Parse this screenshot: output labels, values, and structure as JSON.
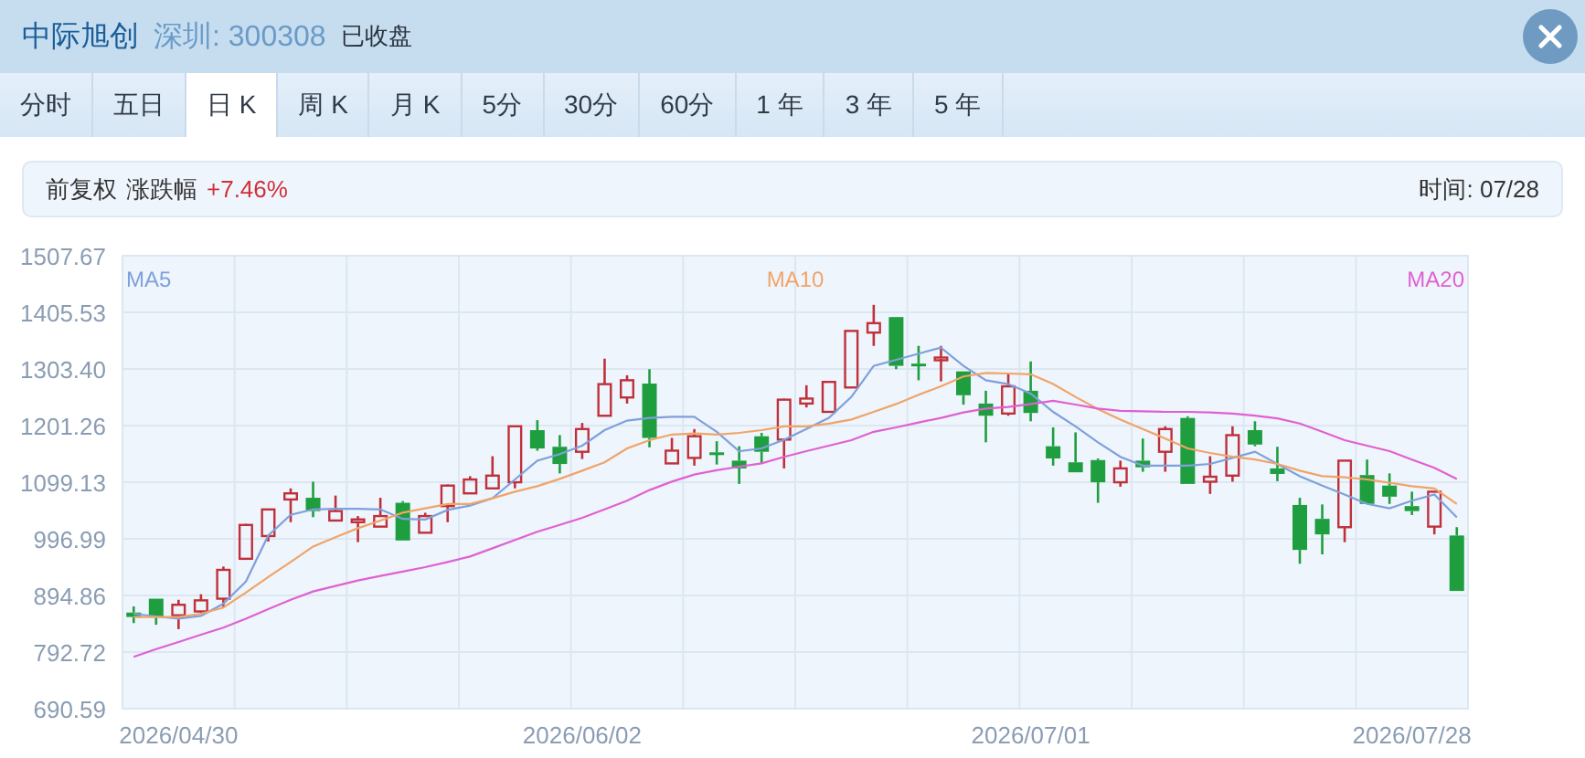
{
  "header": {
    "name": "中际旭创",
    "market": "深圳: 300308",
    "status": "已收盘"
  },
  "tabs": [
    {
      "label": "分时",
      "selected": false
    },
    {
      "label": "五日",
      "selected": false
    },
    {
      "label": "日 K",
      "selected": true
    },
    {
      "label": "周 K",
      "selected": false
    },
    {
      "label": "月 K",
      "selected": false
    },
    {
      "label": "5分",
      "selected": false
    },
    {
      "label": "30分",
      "selected": false
    },
    {
      "label": "60分",
      "selected": false
    },
    {
      "label": "1 年",
      "selected": false
    },
    {
      "label": "3 年",
      "selected": false
    },
    {
      "label": "5 年",
      "selected": false
    }
  ],
  "info": {
    "adjust": "前复权",
    "change_label": "涨跌幅",
    "change": "+7.46%",
    "time": "时间: 07/28"
  },
  "chart": {
    "chart_data": {
      "type": "candlestick",
      "categories": [
        null,
        null,
        "2026/04/30",
        null,
        null,
        null,
        null,
        null,
        null,
        null,
        null,
        null,
        null,
        null,
        null,
        null,
        null,
        null,
        null,
        null,
        "2026/06/02",
        null,
        null,
        null,
        null,
        null,
        null,
        null,
        null,
        null,
        null,
        null,
        null,
        null,
        null,
        null,
        null,
        null,
        null,
        null,
        "2026/07/01",
        null,
        null,
        null,
        null,
        null,
        null,
        null,
        null,
        null,
        null,
        null,
        null,
        null,
        null,
        null,
        null,
        "2026/07/28",
        null,
        null
      ],
      "series": [
        {
          "name": "MA5",
          "type": "line",
          "color": "#7fa0dc",
          "values": [
            862,
            857,
            853,
            858,
            880,
            920,
            1003,
            1040,
            1050,
            1051,
            1051,
            1050,
            1033,
            1032,
            1049,
            1057,
            1070,
            1104,
            1138,
            1150,
            1165,
            1193,
            1210,
            1215,
            1217,
            1217,
            1190,
            1155,
            1160,
            1176,
            1195,
            1215,
            1253,
            1309,
            1320,
            1331,
            1342,
            1309,
            1283,
            1276,
            1259,
            1226,
            1200,
            1171,
            1145,
            1129,
            1129,
            1129,
            1132,
            1143,
            1154,
            1132,
            1110,
            1093,
            1077,
            1060,
            1052,
            1066,
            1077,
            1036
          ]
        },
        {
          "name": "MA10",
          "type": "line",
          "color": "#f0a468",
          "values": [
            856,
            856,
            856,
            862,
            873,
            900,
            928,
            955,
            983,
            1000,
            1016,
            1030,
            1044,
            1052,
            1060,
            1060,
            1070,
            1082,
            1092,
            1105,
            1120,
            1135,
            1160,
            1175,
            1185,
            1187,
            1185,
            1188,
            1193,
            1200,
            1200,
            1205,
            1212,
            1226,
            1240,
            1257,
            1272,
            1290,
            1296,
            1295,
            1294,
            1276,
            1253,
            1231,
            1212,
            1195,
            1178,
            1160,
            1152,
            1145,
            1140,
            1132,
            1120,
            1110,
            1108,
            1104,
            1098,
            1092,
            1088,
            1060
          ]
        },
        {
          "name": "MA20",
          "type": "line",
          "color": "#e060d2",
          "values": [
            784,
            798,
            811,
            824,
            837,
            853,
            870,
            887,
            902,
            912,
            922,
            930,
            938,
            946,
            955,
            965,
            980,
            995,
            1010,
            1022,
            1035,
            1050,
            1066,
            1085,
            1100,
            1113,
            1121,
            1127,
            1133,
            1145,
            1155,
            1165,
            1175,
            1190,
            1198,
            1207,
            1215,
            1225,
            1232,
            1235,
            1240,
            1246,
            1239,
            1232,
            1228,
            1227,
            1226,
            1226,
            1225,
            1223,
            1219,
            1214,
            1205,
            1190,
            1175,
            1165,
            1155,
            1140,
            1125,
            1105
          ]
        }
      ],
      "ohlc": [
        [
          864,
          875,
          845,
          856
        ],
        [
          889,
          889,
          842,
          856
        ],
        [
          859,
          887,
          834,
          878
        ],
        [
          866,
          897,
          864,
          886
        ],
        [
          889,
          947,
          873,
          941
        ],
        [
          961,
          1024,
          959,
          1022
        ],
        [
          1002,
          1051,
          992,
          1050
        ],
        [
          1068,
          1088,
          1027,
          1079
        ],
        [
          1071,
          1100,
          1036,
          1047
        ],
        [
          1030,
          1075,
          1030,
          1047
        ],
        [
          1027,
          1038,
          991,
          1032
        ],
        [
          1019,
          1071,
          1019,
          1038
        ],
        [
          1062,
          1065,
          994,
          994
        ],
        [
          1008,
          1044,
          1008,
          1038
        ],
        [
          1056,
          1095,
          1027,
          1093
        ],
        [
          1079,
          1110,
          1079,
          1104
        ],
        [
          1088,
          1146,
          1088,
          1111
        ],
        [
          1099,
          1201,
          1088,
          1200
        ],
        [
          1193,
          1211,
          1156,
          1160
        ],
        [
          1163,
          1184,
          1115,
          1132
        ],
        [
          1154,
          1206,
          1141,
          1195
        ],
        [
          1219,
          1322,
          1219,
          1276
        ],
        [
          1252,
          1292,
          1241,
          1283
        ],
        [
          1277,
          1303,
          1162,
          1179
        ],
        [
          1133,
          1179,
          1133,
          1156
        ],
        [
          1143,
          1195,
          1129,
          1182
        ],
        [
          1153,
          1173,
          1131,
          1149
        ],
        [
          1138,
          1164,
          1096,
          1124
        ],
        [
          1182,
          1188,
          1132,
          1154
        ],
        [
          1176,
          1250,
          1124,
          1248
        ],
        [
          1241,
          1274,
          1234,
          1250
        ],
        [
          1226,
          1281,
          1226,
          1280
        ],
        [
          1270,
          1373,
          1270,
          1372
        ],
        [
          1369,
          1419,
          1345,
          1386
        ],
        [
          1397,
          1397,
          1303,
          1309
        ],
        [
          1313,
          1345,
          1283,
          1311
        ],
        [
          1322,
          1345,
          1281,
          1324
        ],
        [
          1299,
          1299,
          1239,
          1256
        ],
        [
          1241,
          1264,
          1171,
          1219
        ],
        [
          1223,
          1294,
          1219,
          1272
        ],
        [
          1264,
          1317,
          1209,
          1224
        ],
        [
          1164,
          1198,
          1129,
          1142
        ],
        [
          1135,
          1189,
          1117,
          1117
        ],
        [
          1139,
          1142,
          1062,
          1099
        ],
        [
          1099,
          1138,
          1091,
          1124
        ],
        [
          1138,
          1178,
          1118,
          1126
        ],
        [
          1154,
          1200,
          1118,
          1195
        ],
        [
          1215,
          1218,
          1096,
          1096
        ],
        [
          1100,
          1146,
          1078,
          1109
        ],
        [
          1111,
          1200,
          1100,
          1184
        ],
        [
          1193,
          1209,
          1164,
          1167
        ],
        [
          1124,
          1163,
          1101,
          1114
        ],
        [
          1058,
          1071,
          952,
          977
        ],
        [
          1033,
          1059,
          969,
          1005
        ],
        [
          1018,
          1139,
          991,
          1138
        ],
        [
          1112,
          1140,
          1060,
          1060
        ],
        [
          1093,
          1115,
          1060,
          1073
        ],
        [
          1056,
          1082,
          1040,
          1047
        ],
        [
          1019,
          1083,
          1005,
          1082
        ],
        [
          1003,
          1018,
          903,
          903
        ]
      ],
      "ylim": [
        690.59,
        1507.67
      ],
      "yticks": [
        1507.67,
        1405.53,
        {
          "value": 1303.4,
          "label": "1303.40"
        },
        1201.26,
        1099.13,
        996.99,
        894.86,
        792.72,
        690.59
      ],
      "grid": true
    }
  }
}
